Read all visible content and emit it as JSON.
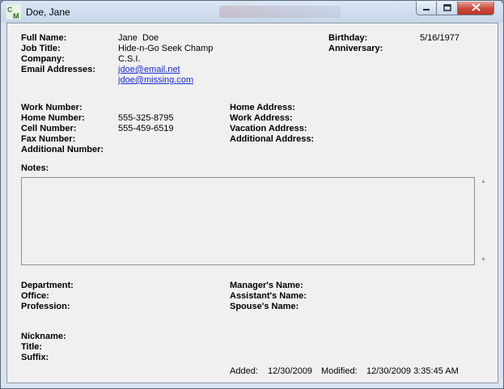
{
  "window": {
    "title": "Doe, Jane"
  },
  "contact": {
    "full_name_label": "Full Name:",
    "full_name": "Jane  Doe",
    "job_title_label": "Job Title:",
    "job_title": "Hide-n-Go Seek Champ",
    "company_label": "Company:",
    "company": "C.S.I.",
    "email_label": "Email Addresses:",
    "emails": [
      "jdoe@email.net",
      "jdoe@missing.com"
    ],
    "birthday_label": "Birthday:",
    "birthday": "5/16/1977",
    "anniversary_label": "Anniversary:",
    "anniversary": ""
  },
  "phones": {
    "work_label": "Work Number:",
    "work": "",
    "home_label": "Home Number:",
    "home": "555-325-8795",
    "cell_label": "Cell Number:",
    "cell": "555-459-6519",
    "fax_label": "Fax Number:",
    "fax": "",
    "additional_label": "Additional Number:",
    "additional": ""
  },
  "addresses": {
    "home_label": "Home Address:",
    "work_label": "Work Address:",
    "vacation_label": "Vacation Address:",
    "additional_label": "Additional Address:"
  },
  "notes": {
    "label": "Notes:",
    "value": ""
  },
  "org": {
    "department_label": "Department:",
    "office_label": "Office:",
    "profession_label": "Profession:",
    "manager_label": "Manager's Name:",
    "assistant_label": "Assistant's Name:",
    "spouse_label": "Spouse's Name:"
  },
  "misc": {
    "nickname_label": "Nickname:",
    "title_label": "Title:",
    "suffix_label": "Suffix:"
  },
  "footer": {
    "added_label": "Added:",
    "added": "12/30/2009",
    "modified_label": "Modified:",
    "modified": "12/30/2009 3:35:45 AM"
  },
  "colors": {
    "link": "#1a2fd1",
    "close_button": "#c9483a",
    "titlebar": "#d3e1f1"
  },
  "icons": [
    "app-logo-icon",
    "minimize-icon",
    "maximize-icon",
    "close-icon",
    "scroll-up-arrow-icon",
    "scroll-down-arrow-icon"
  ]
}
